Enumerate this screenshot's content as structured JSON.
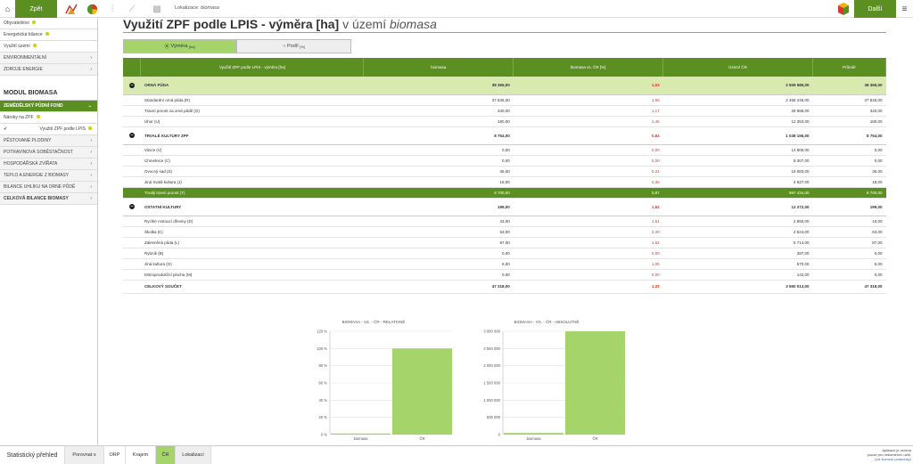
{
  "topbar": {
    "back_label": "Zpět",
    "loc_label": "Lokalizace:",
    "loc_value": "biomasa",
    "next_label": "Další"
  },
  "sidebar": {
    "items": [
      {
        "label": "Obyvatelstvo",
        "dot": true
      },
      {
        "label": "Energetická bilance",
        "dot": true
      },
      {
        "label": "Využití území",
        "dot": true
      },
      {
        "label": "ENVIRONMENTÁLNÍ",
        "caps": true
      },
      {
        "label": "ZDROJE ENERGIE",
        "caps": true
      }
    ],
    "module_title": "MODUL BIOMASA",
    "module_items": [
      {
        "label": "ZEMĚDĚLSKÝ PŮDNÍ FOND",
        "active": true
      },
      {
        "label": "Nároky na ZPF",
        "dot": true
      },
      {
        "label": "Využití ZPF podle LPIS",
        "dot": true,
        "checked": true
      },
      {
        "label": "PĚSTOVANÉ PLODINY",
        "caps": true
      },
      {
        "label": "POTRAVINOVÁ SOBĚSTAČNOST",
        "caps": true
      },
      {
        "label": "HOSPODÁŘSKÁ ZVÍŘATA",
        "caps": true
      },
      {
        "label": "TEPLO A ENERGIE Z BIOMASY",
        "caps": true
      },
      {
        "label": "BILANCE UHLÍKU NA ORNÉ PŮDĚ",
        "caps": true
      },
      {
        "label": "CELKOVÁ BILANCE BIOMASY",
        "caps": true,
        "bold": true
      }
    ]
  },
  "main": {
    "title": "Využití ZPF podle LPIS - výměra [ha]",
    "title_suffix_plain": "v území ",
    "title_suffix_italic": "biomasa",
    "seg_vymera": "Výměra",
    "seg_vymera_unit": "[ha]",
    "seg_podil": "Podíl",
    "seg_podil_unit": "[%]"
  },
  "table": {
    "headers": [
      "Využití ZPF podle LPIS - výměra [ha]",
      "biomasa",
      "biomasa vs. ČR [%]",
      "Území ČR",
      "Průměr"
    ],
    "rows": [
      {
        "t": "grp",
        "lite": true,
        "label": "ORNÁ PŮDA",
        "v": [
          "38 365,00",
          "1,53",
          "2 509 585,00",
          "38 365,00"
        ]
      },
      {
        "label": "Standardní orná půda (R)",
        "v": [
          "37 845,00",
          "1,55",
          "2 468 246,00",
          "37 845,00"
        ]
      },
      {
        "label": "Travní porost na orné půdě (G)",
        "v": [
          "340,00",
          "1,17",
          "28 986,00",
          "340,00"
        ]
      },
      {
        "label": "Úhor (U)",
        "v": [
          "180,00",
          "1,46",
          "12 353,00",
          "180,00"
        ]
      },
      {
        "t": "grp",
        "label": "TRVALÉ KULTURY ZPF",
        "v": [
          "8 754,00",
          "0,84",
          "1 038 156,00",
          "8 754,00"
        ]
      },
      {
        "label": "Vinice (V)",
        "v": [
          "0,00",
          "0,00",
          "14 805,00",
          "0,00"
        ]
      },
      {
        "label": "Chmelnice (C)",
        "v": [
          "0,00",
          "0,00",
          "8 307,00",
          "0,00"
        ]
      },
      {
        "label": "Ovocný sad (S)",
        "v": [
          "36,00",
          "0,24",
          "15 083,00",
          "36,00"
        ]
      },
      {
        "label": "Jiná trvalá kultura (J)",
        "v": [
          "18,00",
          "0,35",
          "4 827,00",
          "18,00"
        ]
      },
      {
        "t": "tot",
        "label": "Trvalý travní porost (T)",
        "v": [
          "8 700,00",
          "0,87",
          "997 434,00",
          "8 700,00"
        ]
      },
      {
        "t": "grp",
        "label": "OSTATNÍ KULTURY",
        "v": [
          "199,00",
          "1,62",
          "12 272,00",
          "199,00"
        ]
      },
      {
        "label": "Rychle rostoucí dřeviny (D)",
        "v": [
          "43,00",
          "1,51",
          "2 850,00",
          "43,00"
        ]
      },
      {
        "label": "Školka (K)",
        "v": [
          "63,00",
          "2,40",
          "2 624,00",
          "63,00"
        ]
      },
      {
        "label": "Zalesněná půda (L)",
        "v": [
          "87,00",
          "1,52",
          "5 714,00",
          "87,00"
        ]
      },
      {
        "label": "Rybník (B)",
        "v": [
          "0,00",
          "0,00",
          "387,00",
          "0,00"
        ]
      },
      {
        "label": "Jiná kultura (O)",
        "v": [
          "6,00",
          "1,05",
          "570,00",
          "6,00"
        ]
      },
      {
        "label": "Mimoprodukční plocha (M)",
        "v": [
          "0,00",
          "0,00",
          "142,00",
          "0,00"
        ]
      },
      {
        "t": "sum",
        "label": "CELKOVÝ SOUČET",
        "v": [
          "47 318,00",
          "1,33",
          "3 560 013,00",
          "47 318,00"
        ]
      }
    ]
  },
  "chart_data": [
    {
      "type": "bar",
      "title": "BIOMASA - VS. - ČR - RELATIVNĚ",
      "categories": [
        "biomasa",
        "ČR"
      ],
      "values": [
        1.33,
        100
      ],
      "ylim": [
        0,
        120
      ],
      "yticks": [
        "0 %",
        "20 %",
        "40 %",
        "60 %",
        "80 %",
        "100 %",
        "120 %"
      ],
      "color": "#a5d46a"
    },
    {
      "type": "bar",
      "title": "BIOMASA - VS. - ČR - ABSOLUTNĚ",
      "categories": [
        "biomasa",
        "ČR"
      ],
      "values": [
        47318,
        3560013
      ],
      "ylim": [
        0,
        3000000
      ],
      "yticks": [
        "0",
        "500 000",
        "1 000 000",
        "1 500 000",
        "2 000 000",
        "2 500 000",
        "3 000 000"
      ],
      "color": "#a5d46a"
    }
  ],
  "bottombar": {
    "stat": "Statistický přehled",
    "compare": "Porovnat s",
    "orp": "ORP",
    "kraj": "Krajem",
    "cr": "ČR",
    "lok": "Lokalizací",
    "foot1": "Aplikace je určena",
    "foot2": "pouze pro nekomerční užití.",
    "foot3": "(viz licenční podmínky)"
  }
}
